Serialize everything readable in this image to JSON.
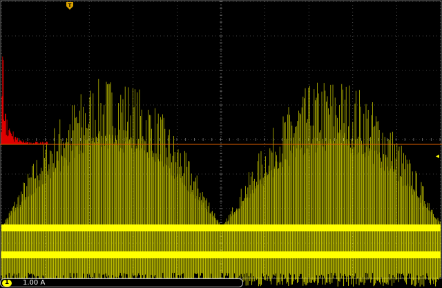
{
  "colors": {
    "background": "#000000",
    "grid": "#8c8c8c",
    "channel1": "#ffff00",
    "math": "#e00000",
    "reference_line": "#e06000"
  },
  "markers": {
    "trigger_position": "T",
    "trigger_level": "◂"
  },
  "status": {
    "channel_number": "1",
    "channel_scale": "1.00 A"
  },
  "icons": {
    "trigger_position": "trigger-position-icon",
    "trigger_level": "trigger-level-arrow-icon"
  }
}
